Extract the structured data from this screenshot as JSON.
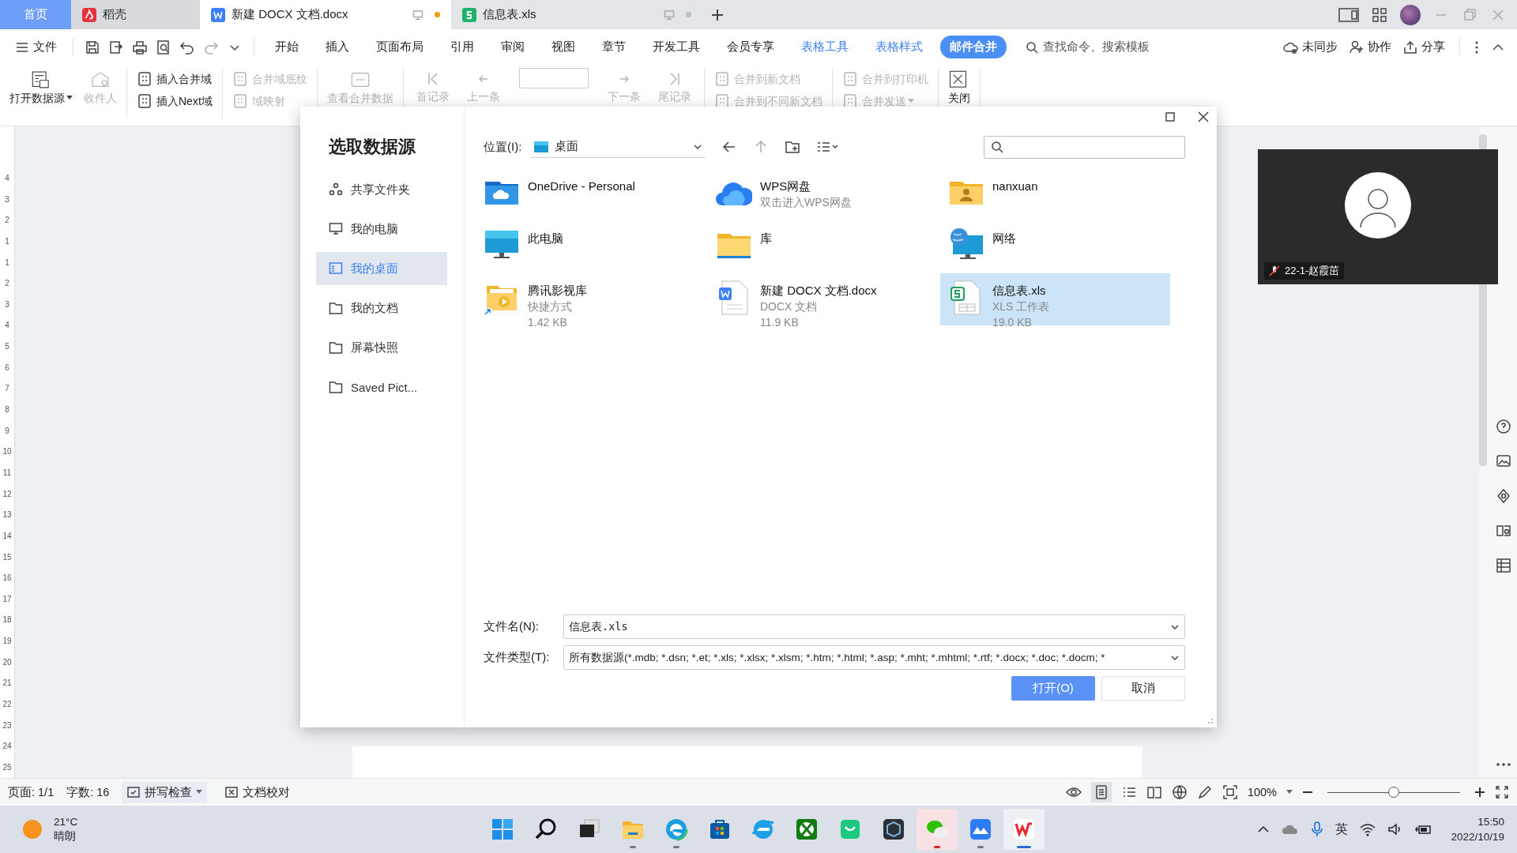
{
  "tabs": [
    {
      "label": "首页",
      "kind": "home",
      "selected": false
    },
    {
      "label": "稻壳",
      "kind": "daoke",
      "selected": false
    },
    {
      "label": "新建 DOCX 文档.docx",
      "kind": "writer",
      "selected": true,
      "modified": true
    },
    {
      "label": "信息表.xls",
      "kind": "sheet",
      "selected": false,
      "modified": false
    }
  ],
  "menu": {
    "file": "文件",
    "items": [
      {
        "label": "开始",
        "kind": "plain",
        "selected": false
      },
      {
        "label": "插入",
        "kind": "plain",
        "selected": false
      },
      {
        "label": "页面布局",
        "kind": "plain",
        "selected": false
      },
      {
        "label": "引用",
        "kind": "plain",
        "selected": false
      },
      {
        "label": "审阅",
        "kind": "plain",
        "selected": false
      },
      {
        "label": "视图",
        "kind": "plain",
        "selected": false
      },
      {
        "label": "章节",
        "kind": "plain",
        "selected": false
      },
      {
        "label": "开发工具",
        "kind": "plain",
        "selected": false
      },
      {
        "label": "会员专享",
        "kind": "plain",
        "selected": false
      },
      {
        "label": "表格工具",
        "kind": "context",
        "selected": false
      },
      {
        "label": "表格样式",
        "kind": "context",
        "selected": false
      },
      {
        "label": "邮件合并",
        "kind": "context",
        "selected": true
      }
    ],
    "search": "查找命令、搜索模板",
    "right": [
      "未同步",
      "协作",
      "分享"
    ]
  },
  "ribbon": [
    {
      "kind": "large",
      "items": [
        {
          "label": "打开数据源",
          "disabled": false,
          "dropdown": true
        },
        {
          "label": "收件人",
          "disabled": true,
          "dropdown": false
        }
      ]
    },
    {
      "kind": "stack",
      "items": [
        {
          "label": "插入合并域",
          "disabled": false,
          "dropdown": false
        },
        {
          "label": "插入Next域",
          "disabled": false,
          "dropdown": false
        }
      ]
    },
    {
      "kind": "stack",
      "items": [
        {
          "label": "合并域底纹",
          "disabled": true,
          "dropdown": false
        },
        {
          "label": "域映射",
          "disabled": true,
          "dropdown": false
        }
      ]
    },
    {
      "kind": "large",
      "items": [
        {
          "label": "查看合并数据",
          "disabled": true,
          "dropdown": false
        }
      ]
    },
    {
      "kind": "nav",
      "items": [
        {
          "label": "首记录",
          "disabled": true,
          "dropdown": false
        },
        {
          "label": "上一条",
          "disabled": true,
          "dropdown": false
        },
        {
          "kind": "field"
        },
        {
          "label": "下一条",
          "disabled": true,
          "dropdown": false
        },
        {
          "label": "尾记录",
          "disabled": true,
          "dropdown": false
        }
      ]
    },
    {
      "kind": "stack",
      "items": [
        {
          "label": "合并到新文档",
          "disabled": true,
          "dropdown": false
        },
        {
          "label": "合并到不同新文档",
          "disabled": true,
          "dropdown": false
        }
      ]
    },
    {
      "kind": "stack",
      "items": [
        {
          "label": "合并到打印机",
          "disabled": true,
          "dropdown": false
        },
        {
          "label": "合并发送",
          "disabled": true,
          "dropdown": true
        }
      ]
    },
    {
      "kind": "large",
      "items": [
        {
          "label": "关闭",
          "disabled": false,
          "dropdown": false
        }
      ]
    }
  ],
  "vertical_ruler": [
    "4",
    "3",
    "2",
    "1",
    "1",
    "2",
    "3",
    "4",
    "5",
    "6",
    "7",
    "8",
    "9",
    "10",
    "11",
    "12",
    "13",
    "14",
    "15",
    "16",
    "17",
    "18",
    "19",
    "20",
    "21",
    "22",
    "23",
    "24",
    "25"
  ],
  "dialog": {
    "title": "选取数据源",
    "location_label": "位置(I):",
    "location": "桌面",
    "sidebar": [
      {
        "label": "共享文件夹",
        "kind": "share",
        "selected": false
      },
      {
        "label": "我的电脑",
        "kind": "pc",
        "selected": false
      },
      {
        "label": "我的桌面",
        "kind": "desktop",
        "selected": true
      },
      {
        "label": "我的文档",
        "kind": "docs",
        "selected": false
      },
      {
        "label": "屏幕快照",
        "kind": "docs",
        "selected": false
      },
      {
        "label": "Saved Pict...",
        "kind": "docs",
        "selected": false
      }
    ],
    "files": [
      {
        "name": "OneDrive - Personal",
        "kind": "onedrive",
        "selected": false
      },
      {
        "name": "WPS网盘",
        "details": [
          "双击进入WPS网盘"
        ],
        "kind": "cloud",
        "selected": false
      },
      {
        "name": "nanxuan",
        "kind": "user-folder",
        "selected": false
      },
      {
        "name": "此电脑",
        "kind": "monitor",
        "selected": false
      },
      {
        "name": "库",
        "kind": "folder",
        "selected": false
      },
      {
        "name": "网络",
        "kind": "network",
        "selected": false
      },
      {
        "name": "腾讯影视库",
        "details": [
          "快捷方式",
          "1.42 KB"
        ],
        "kind": "shortcut",
        "selected": false
      },
      {
        "name": "新建 DOCX 文档.docx",
        "details": [
          "DOCX 文档",
          "11.9 KB"
        ],
        "kind": "docx",
        "selected": false
      },
      {
        "name": "信息表.xls",
        "details": [
          "XLS 工作表",
          "19.0 KB"
        ],
        "kind": "xls",
        "selected": true
      }
    ],
    "filename_label": "文件名(N):",
    "filename": "信息表.xls",
    "filetype_label": "文件类型(T):",
    "filetype": "所有数据源(*.mdb; *.dsn; *.et; *.xls; *.xlsx; *.xlsm; *.htm; *.html; *.asp; *.mht; *.mhtml; *.rtf; *.docx; *.doc; *.docm; *",
    "buttons": [
      {
        "label": "打开(O)",
        "kind": "primary"
      },
      {
        "label": "取消",
        "kind": "secondary"
      }
    ]
  },
  "video": {
    "label": "22-1-赵霞茁",
    "muted": true
  },
  "status_bar": {
    "page": "页面: 1/1",
    "words": "字数: 16",
    "spell": "拼写检查",
    "proof": "文档校对",
    "zoom": "100%",
    "zoom_slider": {
      "level": 0.5
    }
  },
  "taskbar": {
    "weather": {
      "temp": "21°C",
      "desc": "晴朗"
    },
    "apps": [
      {
        "kind": "start",
        "running": false,
        "active": false
      },
      {
        "kind": "search",
        "running": false,
        "active": false
      },
      {
        "kind": "taskview",
        "running": false,
        "active": false
      },
      {
        "kind": "explorer",
        "running": true,
        "active": false
      },
      {
        "kind": "edge",
        "running": true,
        "active": false
      },
      {
        "kind": "store",
        "running": false,
        "active": false
      },
      {
        "kind": "ie",
        "running": false,
        "active": false
      },
      {
        "kind": "xbox",
        "running": false,
        "active": false
      },
      {
        "kind": "shop",
        "running": false,
        "active": false
      },
      {
        "kind": "box",
        "running": false,
        "active": false
      },
      {
        "kind": "wechat",
        "running": true,
        "active": false
      },
      {
        "kind": "feishu",
        "running": true,
        "active": false
      },
      {
        "kind": "wps",
        "running": true,
        "active": true
      }
    ],
    "ime": "英",
    "time": "15:50",
    "date": "2022/10/19"
  }
}
